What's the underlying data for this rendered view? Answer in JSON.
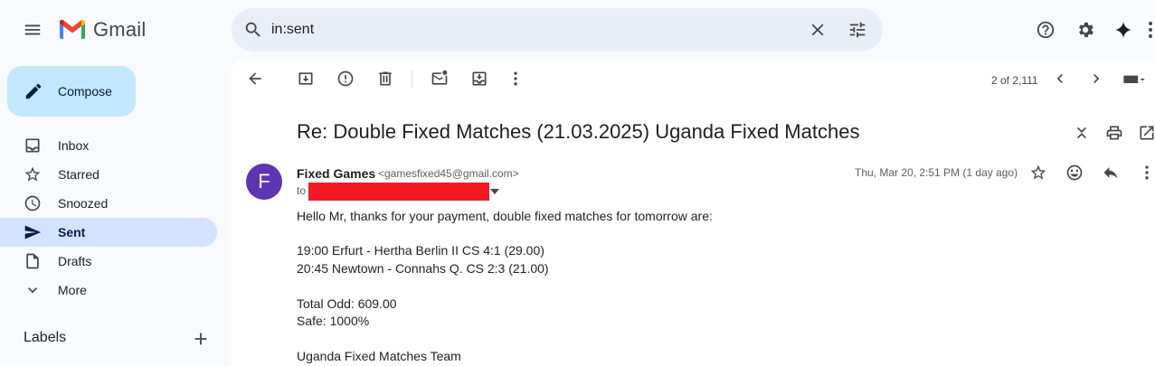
{
  "app": {
    "name": "Gmail"
  },
  "search": {
    "value": "in:sent"
  },
  "sidebar": {
    "compose_label": "Compose",
    "items": [
      {
        "label": "Inbox"
      },
      {
        "label": "Starred"
      },
      {
        "label": "Snoozed"
      },
      {
        "label": "Sent"
      },
      {
        "label": "Drafts"
      },
      {
        "label": "More"
      }
    ],
    "labels_title": "Labels"
  },
  "toolbar": {
    "pager": "2 of 2,111"
  },
  "email": {
    "subject": "Re: Double Fixed Matches (21.03.2025) Uganda Fixed Matches",
    "avatar_letter": "F",
    "sender_name": "Fixed Games",
    "sender_email": "<gamesfixed45@gmail.com>",
    "to_label": "to",
    "date": "Thu, Mar 20, 2:51 PM (1 day ago)",
    "body": [
      "Hello Mr, thanks for your payment, double fixed matches for tomorrow are:",
      "19:00 Erfurt - Hertha Berlin II CS 4:1 (29.00)",
      "20:45 Newtown - Connahs Q. CS 2:3 (21.00)",
      "Total Odd: 609.00",
      "Safe: 1000%",
      "Uganda Fixed Matches Team"
    ]
  },
  "colors": {
    "background": "#f8fafd",
    "compose": "#c2e7ff",
    "active_nav": "#d3e3fd",
    "avatar": "#5e35b1",
    "redaction": "#f21b25"
  }
}
